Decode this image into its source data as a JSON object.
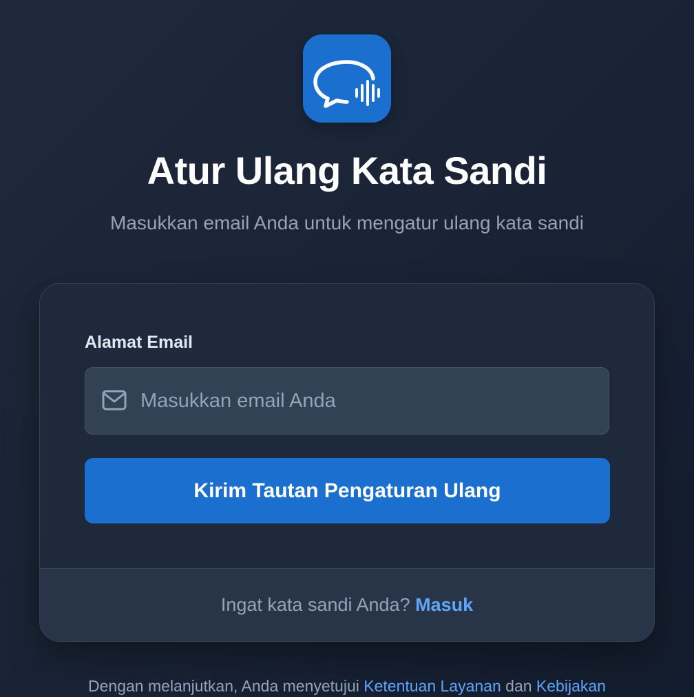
{
  "header": {
    "logo_icon": "chat-bubble-soundwave-icon",
    "title": "Atur Ulang Kata Sandi",
    "subtitle": "Masukkan email Anda untuk mengatur ulang kata sandi"
  },
  "form": {
    "email_label": "Alamat Email",
    "email_icon": "mail-icon",
    "email_value": "",
    "email_placeholder": "Masukkan email Anda",
    "submit_label": "Kirim Tautan Pengaturan Ulang"
  },
  "footer": {
    "prompt": "Ingat kata sandi Anda? ",
    "signin_link": "Masuk"
  },
  "legal": {
    "prefix": "Dengan melanjutkan, Anda menyetujui ",
    "terms_link": "Ketentuan Layanan",
    "joiner": " dan ",
    "privacy_link": "Kebijakan"
  },
  "colors": {
    "accent": "#1b6fcf",
    "link": "#60a5fa",
    "background": "#1e293b",
    "muted_text": "#94a3b8"
  }
}
